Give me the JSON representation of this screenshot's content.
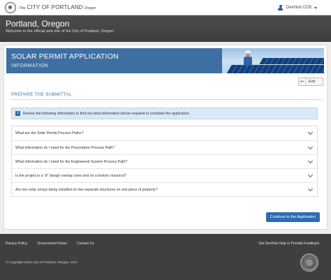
{
  "topbar": {
    "brand_the": "The",
    "brand_city": "CITY OF PORTLAND",
    "brand_state": "Oregon",
    "user_name": "DevHub CCB"
  },
  "header": {
    "title": "Portland, Oregon",
    "subtitle": "Welcome to the official web site of the City of Portland, Oregon"
  },
  "banner": {
    "title": "SOLAR PERMIT APPLICATION",
    "subtitle": "INFORMATION"
  },
  "exit_label": "Exit",
  "section_title": "PREPARE THE SUBMITTAL",
  "info_text": "Review the following information to find out what information will be required to complete the application.",
  "accordion": [
    {
      "question": "What are the Solar Permit Process Paths?"
    },
    {
      "question": "What information do I need for the Prescriptive Process Path?"
    },
    {
      "question": "What information do I need for the Engineered System Process Path?"
    },
    {
      "question": "Is the project in a \"d\" design overlay zone and on a historic resource?"
    },
    {
      "question": "Are two solar arrays being installed on two separate structures on one piece of property?"
    }
  ],
  "continue_label": "Continue to the Application",
  "footer": {
    "links": [
      "Privacy Policy",
      "Government Home",
      "Contact Us"
    ],
    "help": "Get DevHub Help or Provide Feedback",
    "copyright": "© Copyright 2022 City of Portland, Oregon, USA"
  },
  "colors": {
    "accent": "#3d6fa3",
    "button": "#2a6db5",
    "header_bg": "#444444",
    "footer_bg": "#3f3f3f",
    "info_bg": "#d9e9f7"
  }
}
